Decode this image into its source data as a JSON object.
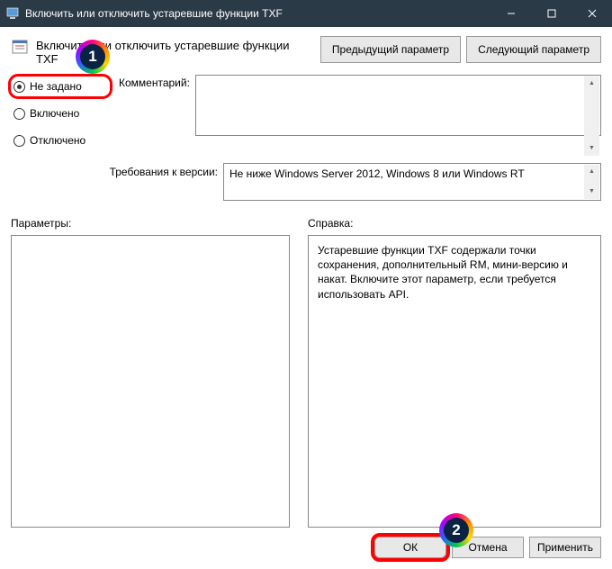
{
  "window": {
    "title": "Включить или отключить устаревшие функции TXF"
  },
  "setting": {
    "title": "Включить или отключить устаревшие функции TXF"
  },
  "nav": {
    "prev": "Предыдущий параметр",
    "next": "Следующий параметр"
  },
  "radio": {
    "not_configured": "Не задано",
    "enabled": "Включено",
    "disabled": "Отключено",
    "selected": "not_configured"
  },
  "comment": {
    "label": "Комментарий:",
    "value": ""
  },
  "version": {
    "label": "Требования к версии:",
    "value": "Не ниже Windows Server 2012, Windows 8 или Windows RT"
  },
  "labels": {
    "params": "Параметры:",
    "help": "Справка:"
  },
  "params_text": "",
  "help_text": "Устаревшие функции TXF содержали точки сохранения, дополнительный RM, мини-версию и накат. Включите этот параметр, если требуется использовать API.",
  "buttons": {
    "ok": "ОК",
    "cancel": "Отмена",
    "apply": "Применить"
  },
  "annotations": {
    "badge1": "1",
    "badge2": "2"
  },
  "icons": {
    "app": "app-icon",
    "setting": "setting-icon"
  }
}
